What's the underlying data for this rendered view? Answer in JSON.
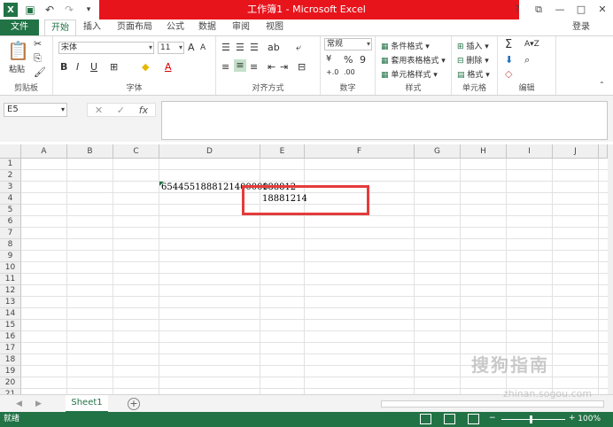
{
  "window": {
    "title": "工作簿1 - Microsoft Excel",
    "min": "—",
    "max": "□",
    "close": "✕",
    "help": "?",
    "restore": "⧉"
  },
  "tabs": {
    "file": "文件",
    "items": [
      "开始",
      "插入",
      "页面布局",
      "公式",
      "数据",
      "审阅",
      "视图"
    ],
    "login": "登录"
  },
  "ribbon": {
    "clipboard": {
      "label": "剪贴板",
      "paste": "粘贴"
    },
    "font": {
      "label": "字体",
      "name": "宋体",
      "size": "11",
      "grow": "A",
      "shrink": "A"
    },
    "alignment": {
      "label": "对齐方式"
    },
    "number": {
      "label": "数字",
      "format": "常规",
      "percent": "%",
      "comma": "9"
    },
    "styles": {
      "label": "样式",
      "conditional": "条件格式",
      "table": "套用表格格式",
      "cell": "单元格样式"
    },
    "cells": {
      "label": "单元格",
      "insert": "插入",
      "delete": "删除",
      "format": "格式"
    },
    "editing": {
      "label": "编辑"
    }
  },
  "formula_bar": {
    "name_box": "E5",
    "fx": "fx",
    "value": ""
  },
  "grid": {
    "columns": [
      "A",
      "B",
      "C",
      "D",
      "E",
      "F",
      "G",
      "H",
      "I",
      "J"
    ],
    "rows": [
      "1",
      "2",
      "3",
      "4",
      "5",
      "6",
      "7",
      "8",
      "9",
      "10",
      "11",
      "12",
      "13",
      "14",
      "15",
      "16",
      "17",
      "18",
      "19",
      "20",
      "21"
    ],
    "cells": {
      "D3": "6544551888121400000",
      "E3": "188812",
      "E4": "18881214"
    }
  },
  "sheets": {
    "active": "Sheet1",
    "add": "+"
  },
  "status": {
    "ready": "就绪",
    "zoom": "100%",
    "zoom_out": "−",
    "zoom_in": "+"
  },
  "watermark": {
    "brand": "搜狗指南",
    "url": "zhinan.sogou.com"
  },
  "colors": {
    "excel_green": "#217346",
    "title_red": "#e8141c",
    "highlight_red": "#e53b3b"
  }
}
